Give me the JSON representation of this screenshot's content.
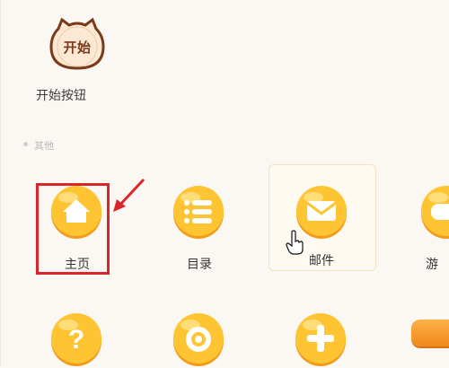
{
  "start": {
    "badge_text": "开始",
    "label": "开始按钮"
  },
  "section": {
    "label": "其他"
  },
  "tiles": [
    {
      "label": "主页",
      "icon": "home-icon"
    },
    {
      "label": "目录",
      "icon": "list-icon"
    },
    {
      "label": "邮件",
      "icon": "mail-icon"
    },
    {
      "label": "游",
      "icon": "game-icon"
    }
  ],
  "row2": [
    {
      "icon": "help-icon"
    },
    {
      "icon": "settings-icon"
    },
    {
      "icon": "add-icon"
    }
  ],
  "colors": {
    "accent_red": "#d9262b",
    "ball_yellow": "#ffc431",
    "ball_orange": "#f7a51e"
  }
}
